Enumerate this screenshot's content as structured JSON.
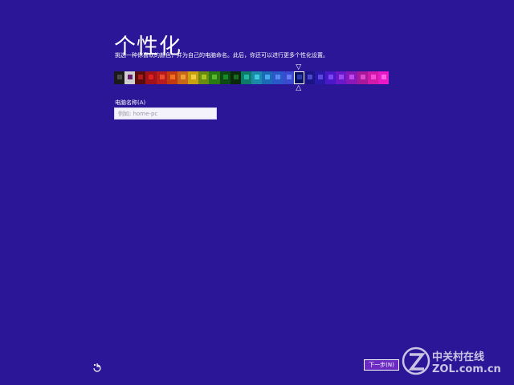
{
  "header": {
    "title": "个性化",
    "description": "挑选一种你喜欢的颜色，并为自己的电脑命名。此后，你还可以进行更多个性化设置。"
  },
  "palette": {
    "swatches": [
      {
        "bg": "#1a1a1a",
        "fg": "#4a4a4a"
      },
      {
        "bg": "#cfcfcf",
        "fg": "#6a1a6a"
      },
      {
        "bg": "#5a0d0d",
        "fg": "#b01a1a"
      },
      {
        "bg": "#a0121a",
        "fg": "#e02020"
      },
      {
        "bg": "#b81c1c",
        "fg": "#e84a2a"
      },
      {
        "bg": "#c23a12",
        "fg": "#f07020"
      },
      {
        "bg": "#c8661a",
        "fg": "#f0a030"
      },
      {
        "bg": "#c8a010",
        "fg": "#f0d040"
      },
      {
        "bg": "#6a8a10",
        "fg": "#a8c820"
      },
      {
        "bg": "#2a7a12",
        "fg": "#58b830"
      },
      {
        "bg": "#0e4a14",
        "fg": "#1a8a28"
      },
      {
        "bg": "#0a2a0e",
        "fg": "#1a6a20"
      },
      {
        "bg": "#0e7a6a",
        "fg": "#20b8a0"
      },
      {
        "bg": "#1a8aa8",
        "fg": "#40c8e0"
      },
      {
        "bg": "#1a6ab8",
        "fg": "#48a8f0"
      },
      {
        "bg": "#2a58c8",
        "fg": "#5a8af0"
      },
      {
        "bg": "#3a4ad0",
        "fg": "#6a7af0"
      },
      {
        "bg": "#0a1060",
        "fg": "#2a3aa8"
      },
      {
        "bg": "#1a1488",
        "fg": "#4a48c8"
      },
      {
        "bg": "#2a18a8",
        "fg": "#5a48e0"
      },
      {
        "bg": "#4a18c8",
        "fg": "#7a48f0"
      },
      {
        "bg": "#6a18c8",
        "fg": "#9a48f0"
      },
      {
        "bg": "#8a18b8",
        "fg": "#c048f0"
      },
      {
        "bg": "#a8189a",
        "fg": "#e048d0"
      },
      {
        "bg": "#d21aa8",
        "fg": "#f848d8"
      },
      {
        "bg": "#e81ac8",
        "fg": "#ff60e8"
      }
    ],
    "selected_index": 17,
    "indicator_top": "▽",
    "indicator_bottom": "△"
  },
  "computer_name": {
    "label": "电脑名称(A)",
    "placeholder": "例如: home-pc"
  },
  "footer": {
    "next_label": "下一步(N)",
    "ease_icon": "ease-of-access-icon"
  },
  "watermark": {
    "line1": "中关村在线",
    "line2": "ZOL.com.cn"
  }
}
